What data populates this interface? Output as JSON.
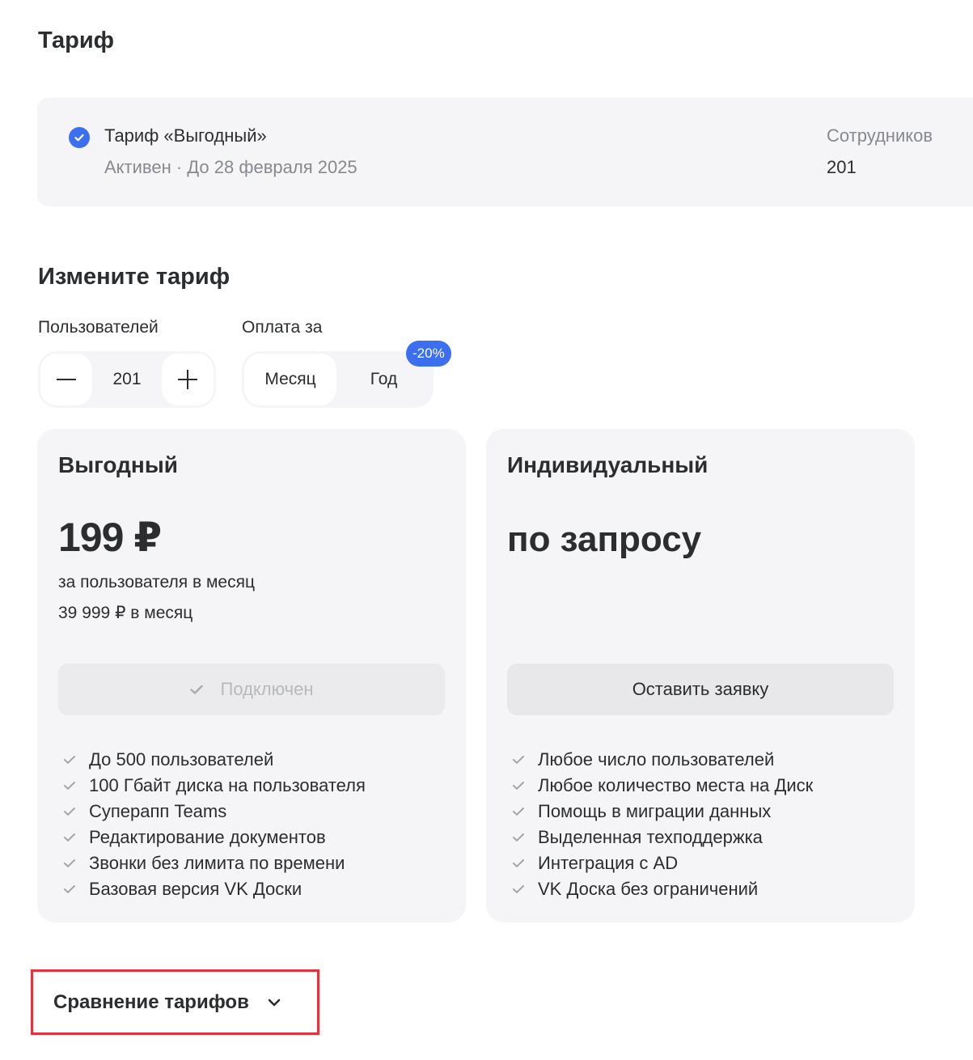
{
  "header": {
    "title": "Тариф"
  },
  "current_plan": {
    "name": "Тариф «Выгодный»",
    "status": "Активен · До 28 февраля 2025",
    "employees_label": "Сотрудников",
    "employees_value": "201"
  },
  "change": {
    "title": "Измените тариф",
    "users_label": "Пользователей",
    "users_value": "201",
    "payment_label": "Оплата за",
    "period_month": "Месяц",
    "period_year": "Год",
    "period_selected": "Месяц",
    "discount_badge": "-20%"
  },
  "plans": [
    {
      "name": "Выгодный",
      "price": "199 ₽",
      "per_user": "за пользователя в месяц",
      "total": "39 999 ₽ в месяц",
      "button_label": "Подключен",
      "features": [
        "До 500 пользователей",
        "100 Гбайт диска на пользователя",
        "Суперапп Teams",
        "Редактирование документов",
        "Звонки без лимита по времени",
        "Базовая версия VK Доски"
      ]
    },
    {
      "name": "Индивидуальный",
      "price": "по запросу",
      "button_label": "Оставить заявку",
      "features": [
        "Любое число пользователей",
        "Любое количество места на Диск",
        "Помощь в миграции данных",
        "Выделенная техподдержка",
        "Интеграция с AD",
        "VK Доска без ограничений"
      ]
    }
  ],
  "compare": {
    "label": "Сравнение тарифов"
  },
  "colors": {
    "accent": "#3c6ef0",
    "card_bg": "#f5f5f7",
    "highlight_border": "#e5323b"
  }
}
